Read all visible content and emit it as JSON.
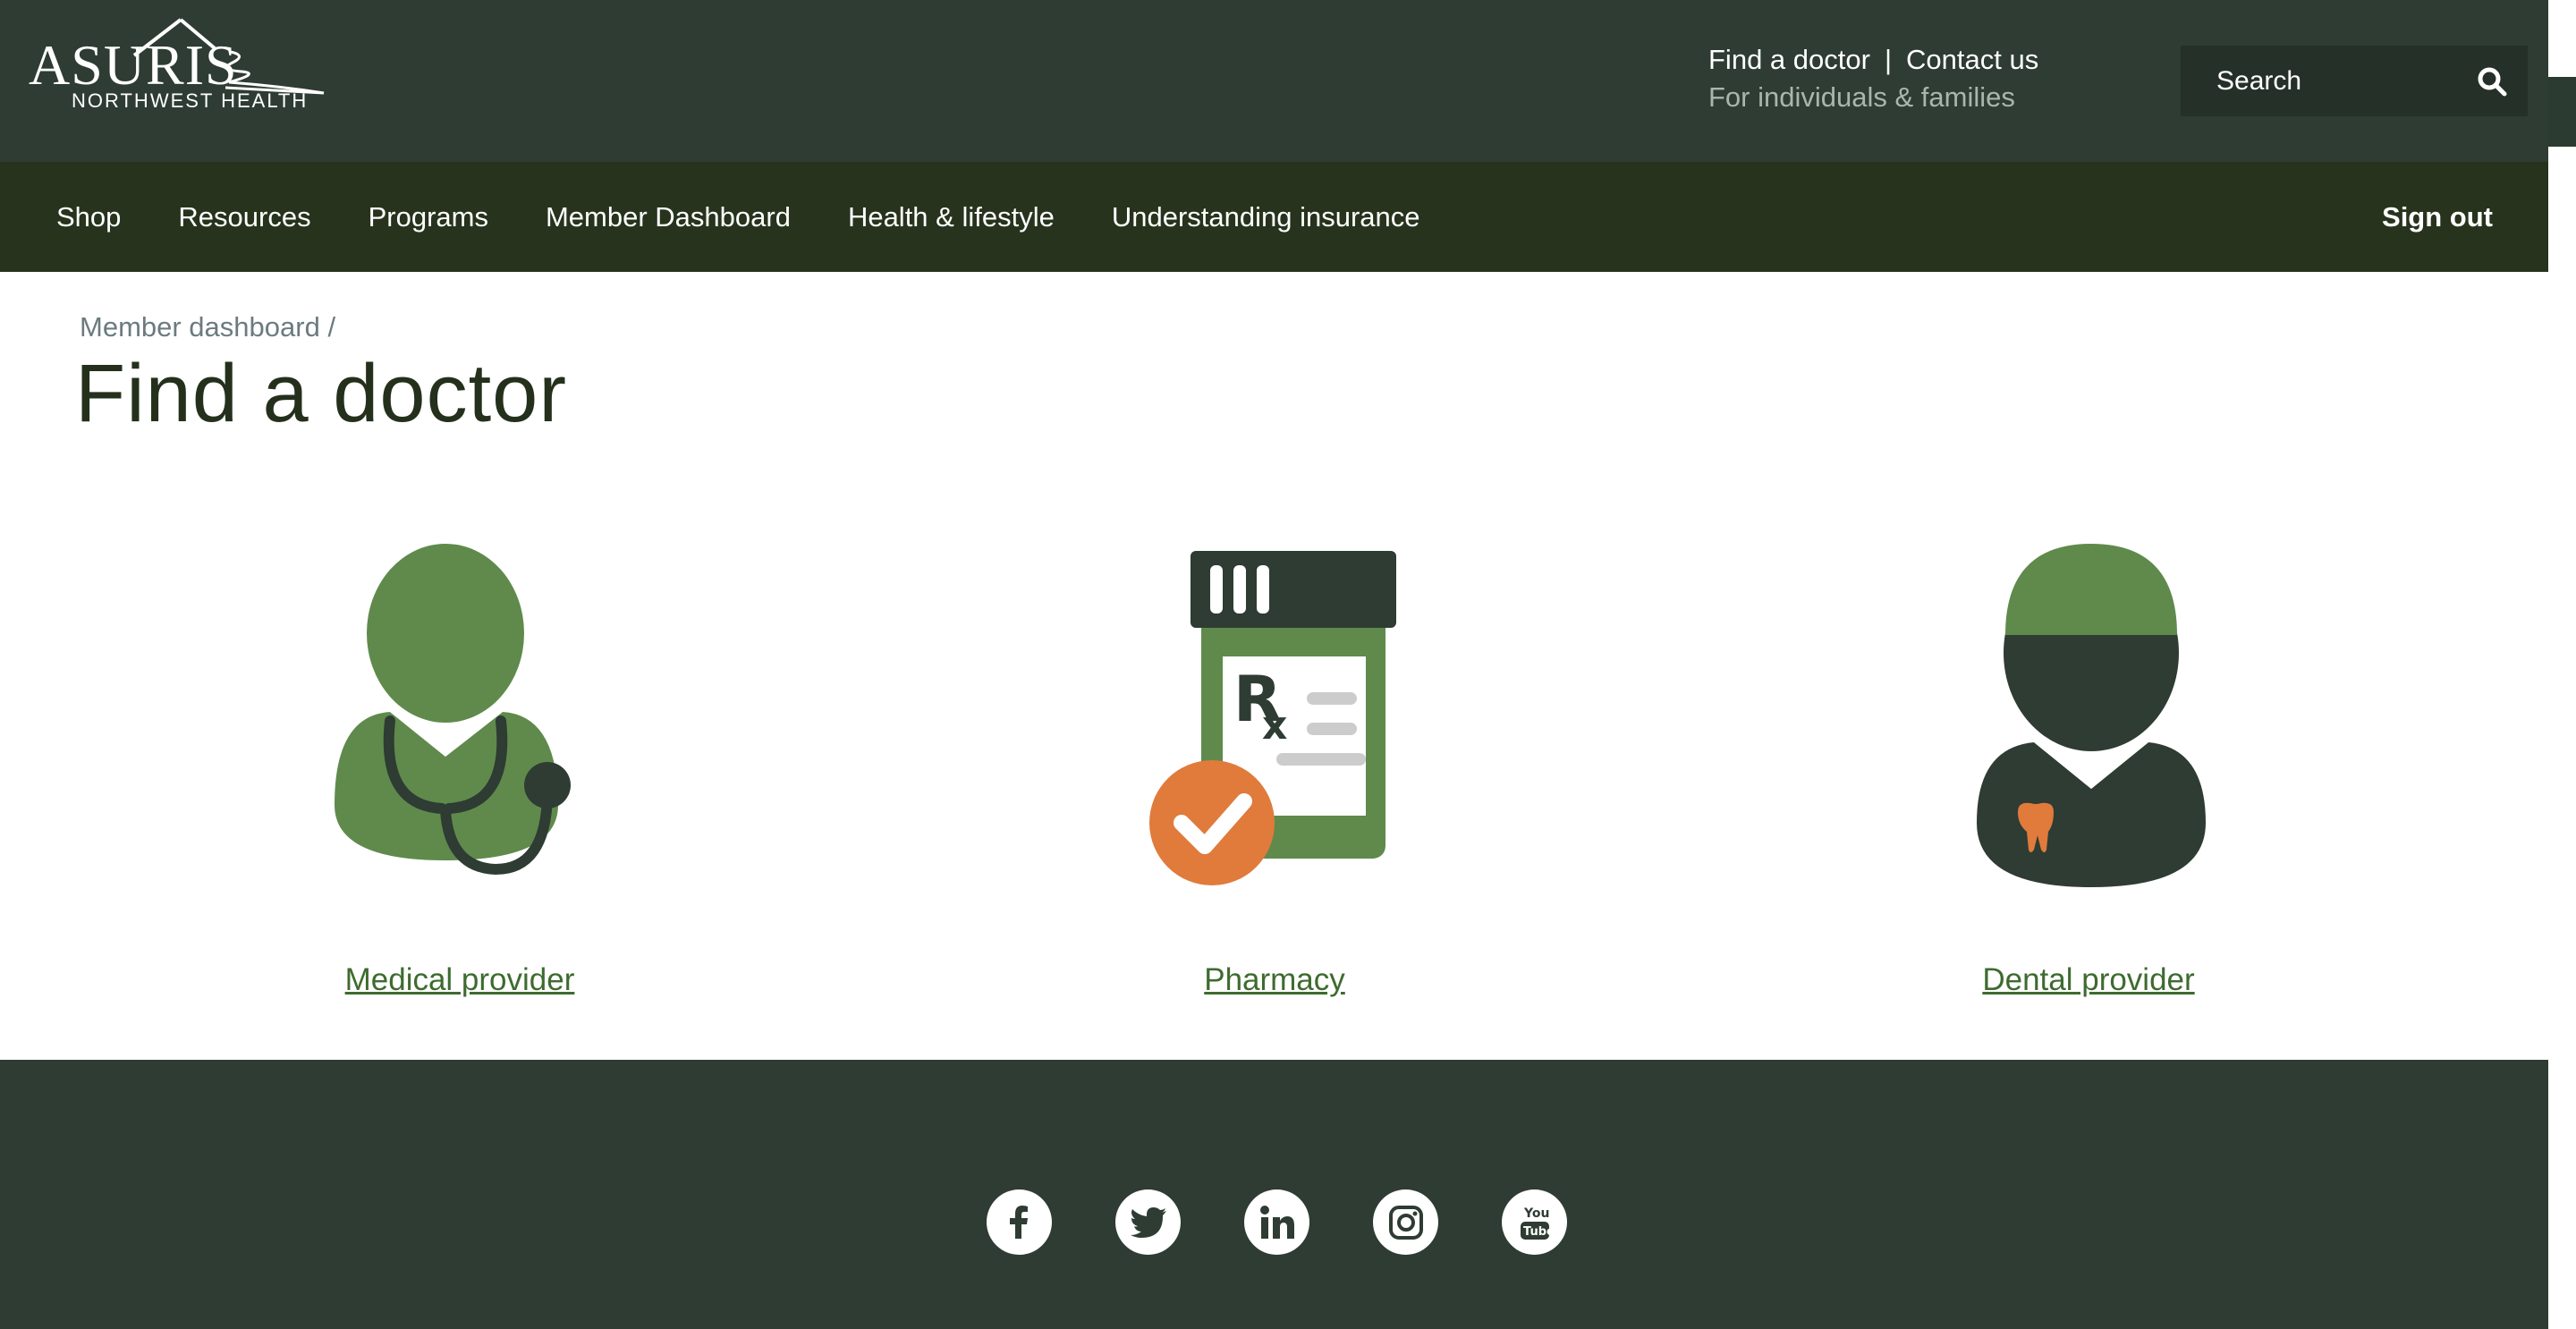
{
  "brand": {
    "name": "ASURIS",
    "tagline": "NORTHWEST HEALTH"
  },
  "utility": {
    "find_doctor": "Find a doctor",
    "separator": "|",
    "contact_us": "Contact us",
    "audience": "For individuals & families"
  },
  "search": {
    "placeholder": "Search"
  },
  "nav": {
    "items": [
      {
        "label": "Shop"
      },
      {
        "label": "Resources"
      },
      {
        "label": "Programs"
      },
      {
        "label": "Member Dashboard"
      },
      {
        "label": "Health & lifestyle"
      },
      {
        "label": "Understanding insurance"
      }
    ],
    "sign_out": "Sign out"
  },
  "breadcrumb": {
    "parent": "Member dashboard",
    "separator": "/"
  },
  "page": {
    "title": "Find a doctor"
  },
  "providers": [
    {
      "label": "Medical provider",
      "icon": "doctor-icon"
    },
    {
      "label": "Pharmacy",
      "icon": "pharmacy-icon"
    },
    {
      "label": "Dental provider",
      "icon": "dentist-icon"
    }
  ],
  "footer": {
    "social": [
      "facebook-icon",
      "twitter-icon",
      "linkedin-icon",
      "instagram-icon",
      "youtube-icon"
    ]
  },
  "colors": {
    "header_bg": "#2e3c33",
    "nav_bg": "#27331d",
    "accent_green": "#5f8a4c",
    "dark_icon": "#2e3c33",
    "orange": "#e07b3c",
    "link_green": "#3e6b2f"
  }
}
